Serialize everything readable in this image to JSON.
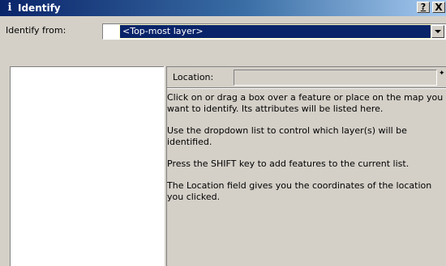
{
  "window": {
    "title": "Identify",
    "title_icon": "info-icon",
    "help_label": "?",
    "close_label": "X"
  },
  "toolbar": {
    "identify_from_label": "Identify from:",
    "layer_select_value": "<Top-most layer>"
  },
  "details": {
    "location_label": "Location:",
    "location_value": "",
    "instructions": [
      "Click on or drag a box over a feature or place on the map you want to identify. Its attributes will be listed here.",
      "Use the dropdown list to control which layer(s) will be identified.",
      "Press the SHIFT key to add features to the current list.",
      "The Location field gives you the coordinates of the location you clicked."
    ]
  },
  "colors": {
    "titlebar_start": "#0a246a",
    "titlebar_end": "#a6caf0",
    "selection": "#0a246a",
    "face": "#d4d0c8"
  }
}
